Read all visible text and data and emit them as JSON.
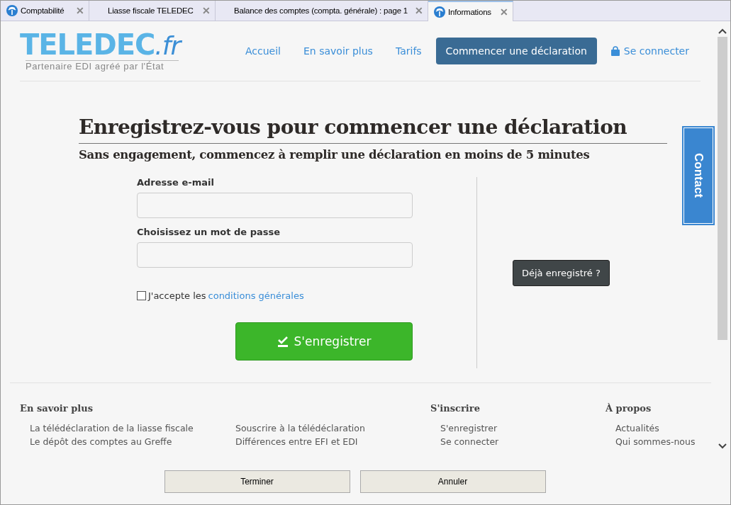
{
  "tabs": [
    {
      "label": "Comptabilité",
      "selected": false,
      "icon": true,
      "close": "✕"
    },
    {
      "label": "Liasse fiscale TELEDEC",
      "selected": false,
      "icon": false,
      "close": "✕"
    },
    {
      "label": "Balance des comptes (compta. générale) : page 1",
      "selected": false,
      "icon": false,
      "close": "✕"
    },
    {
      "label": "Informations",
      "selected": true,
      "icon": true,
      "close": "✕"
    }
  ],
  "logo": {
    "brand": "TELEDEC",
    "suffix": ".fr",
    "tagline": "Partenaire EDI agréé par l'État"
  },
  "nav": [
    {
      "label": "Accueil",
      "kind": "link"
    },
    {
      "label": "En savoir plus",
      "kind": "link"
    },
    {
      "label": "Tarifs",
      "kind": "link"
    },
    {
      "label": "Commencer une déclaration",
      "kind": "primary"
    },
    {
      "label": "Se connecter",
      "kind": "login"
    }
  ],
  "heading": "Enregistrez-vous pour commencer une déclaration",
  "subheading": "Sans engagement, commencez à remplir une déclaration en moins de 5 minutes",
  "form": {
    "email_label": "Adresse e-mail",
    "password_label": "Choisissez un mot de passe",
    "terms_prefix": "J'accepte les",
    "terms_link": "conditions générales",
    "terms_checked": false,
    "submit": "S'enregistrer"
  },
  "already": "Déjà enregistré ?",
  "contact": "Contact",
  "footer": [
    {
      "title": "En savoir plus",
      "links": [
        "La télédéclaration de la liasse fiscale",
        "Le dépôt des comptes au Greffe"
      ]
    },
    {
      "links": [
        "Souscrire à la télédéclaration",
        "Différences entre EFI et EDI"
      ]
    },
    {
      "title": "S'inscrire",
      "links": [
        "S'enregistrer",
        "Se connecter"
      ]
    },
    {
      "title": "À propos",
      "links": [
        "Actualités",
        "Qui sommes-nous"
      ]
    }
  ],
  "buttons": [
    "Terminer",
    "Annuler"
  ]
}
